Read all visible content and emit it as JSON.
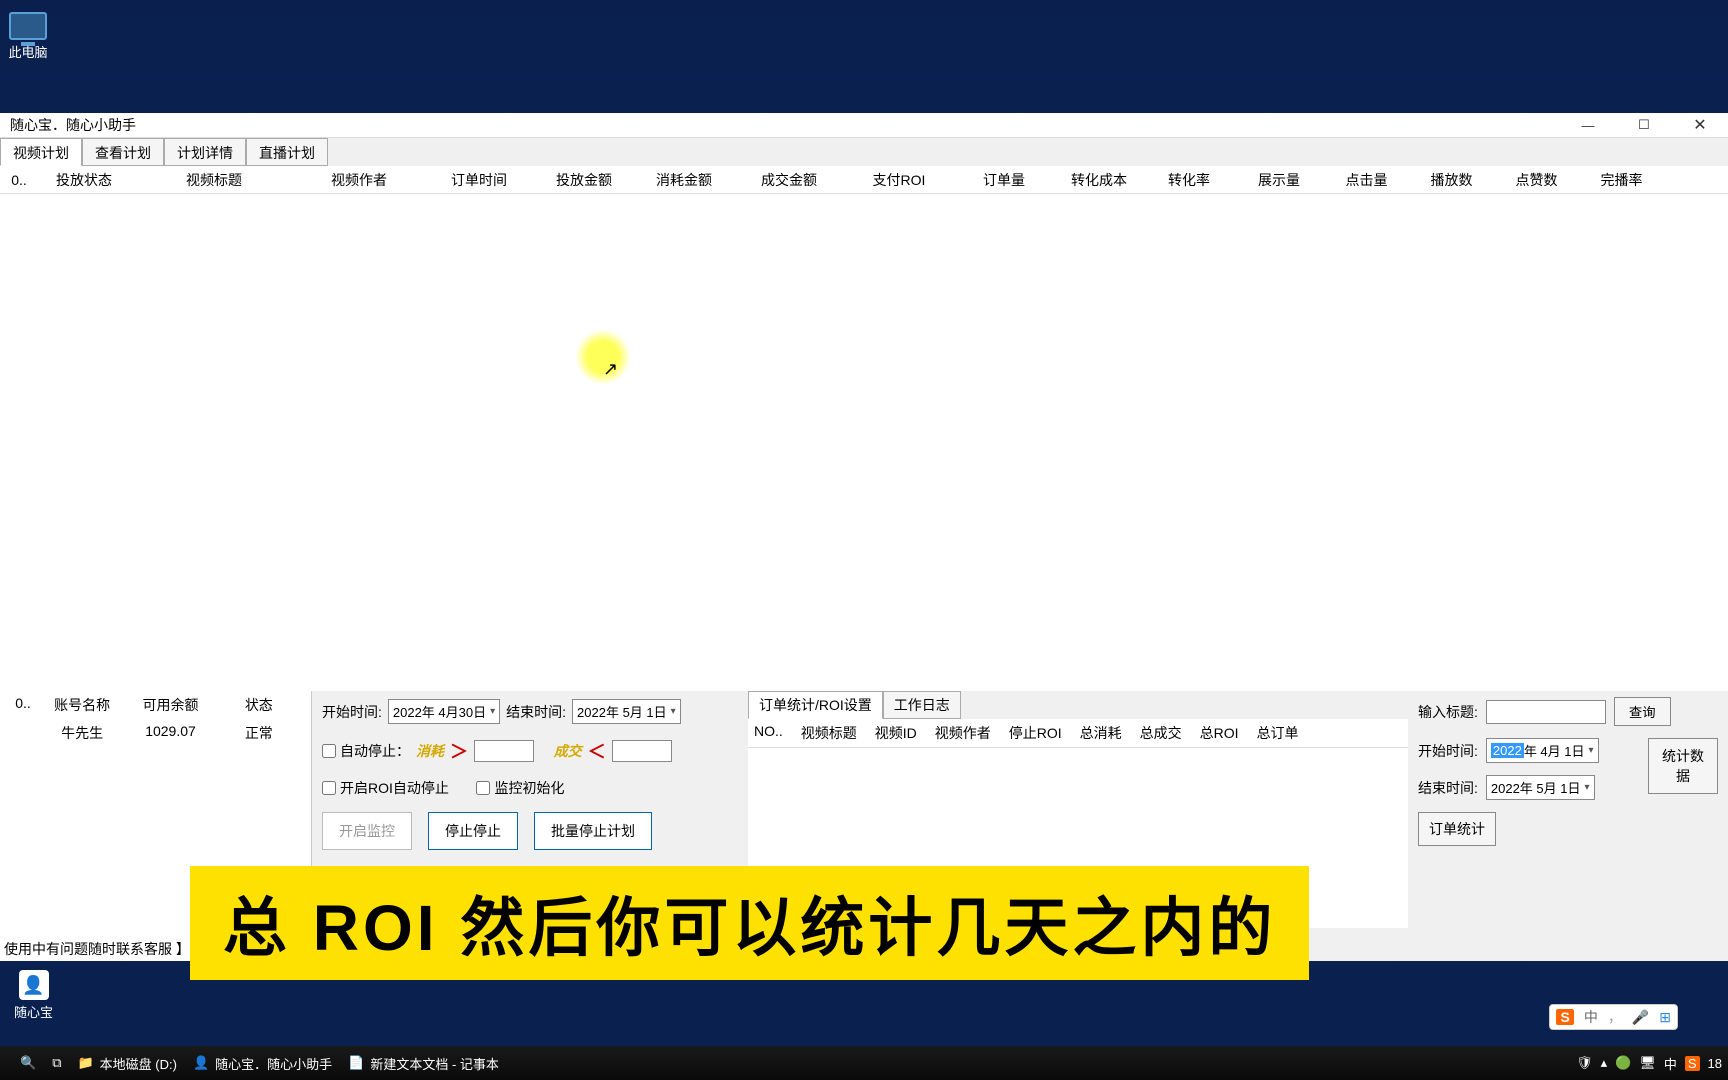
{
  "desktop": {
    "this_pc": "此电脑"
  },
  "window": {
    "title": "随心宝．随心小助手",
    "tabs": {
      "t1": "视频计划",
      "t2": "查看计划",
      "t3": "计划详情",
      "t4": "直播计划"
    },
    "columns": {
      "c0": "0..",
      "c1": "投放状态",
      "c2": "视频标题",
      "c3": "视频作者",
      "c4": "订单时间",
      "c5": "投放金额",
      "c6": "消耗金额",
      "c7": "成交金额",
      "c8": "支付ROI",
      "c9": "订单量",
      "c10": "转化成本",
      "c11": "转化率",
      "c12": "展示量",
      "c13": "点击量",
      "c14": "播放数",
      "c15": "点赞数",
      "c16": "完播率"
    }
  },
  "account": {
    "headers": {
      "no": "0..",
      "name": "账号名称",
      "balance": "可用余额",
      "status": "状态"
    },
    "row": {
      "no": "",
      "name": "牛先生",
      "balance": "1029.07",
      "status": "正常"
    }
  },
  "controls": {
    "start_time_label": "开始时间:",
    "start_time_val": "2022年 4月30日",
    "end_time_label": "结束时间:",
    "end_time_val": "2022年 5月 1日",
    "auto_stop": "自动停止：",
    "consume_label": "消耗",
    "deal_label": "成交",
    "roi_auto_stop": "开启ROI自动停止",
    "monitor_init": "监控初始化",
    "btn_start": "开启监控",
    "btn_stop": "停止停止",
    "btn_batch": "批量停止计划"
  },
  "stats": {
    "sub_tabs": {
      "t1": "订单统计/ROI设置",
      "t2": "工作日志"
    },
    "headers": {
      "c1": "NO..",
      "c2": "视频标题",
      "c3": "视频ID",
      "c4": "视频作者",
      "c5": "停止ROI",
      "c6": "总消耗",
      "c7": "总成交",
      "c8": "总ROI",
      "c9": "总订单"
    }
  },
  "filter": {
    "title_label": "输入标题:",
    "query_btn": "查询",
    "start_time_label": "开始时间:",
    "start_time_val_year": "2022",
    "start_time_val_rest": "年 4月 1日",
    "end_time_label": "结束时间:",
    "end_time_val": "2022年 5月 1日",
    "stats_data_btn": "统计数据",
    "order_stats_btn": "订单统计"
  },
  "footer_note": "使用中有问题随时联系客服 】",
  "subtitle": "总 ROI  然后你可以统计几天之内的",
  "tray": {
    "label": "随心宝"
  },
  "ime": {
    "zhong": "中",
    "comma": "，"
  },
  "taskbar": {
    "disk": "本地磁盘 (D:)",
    "app1": "随心宝．随心小助手",
    "app2": "新建文本文档 - 记事本",
    "zhong": "中",
    "time": "18"
  }
}
